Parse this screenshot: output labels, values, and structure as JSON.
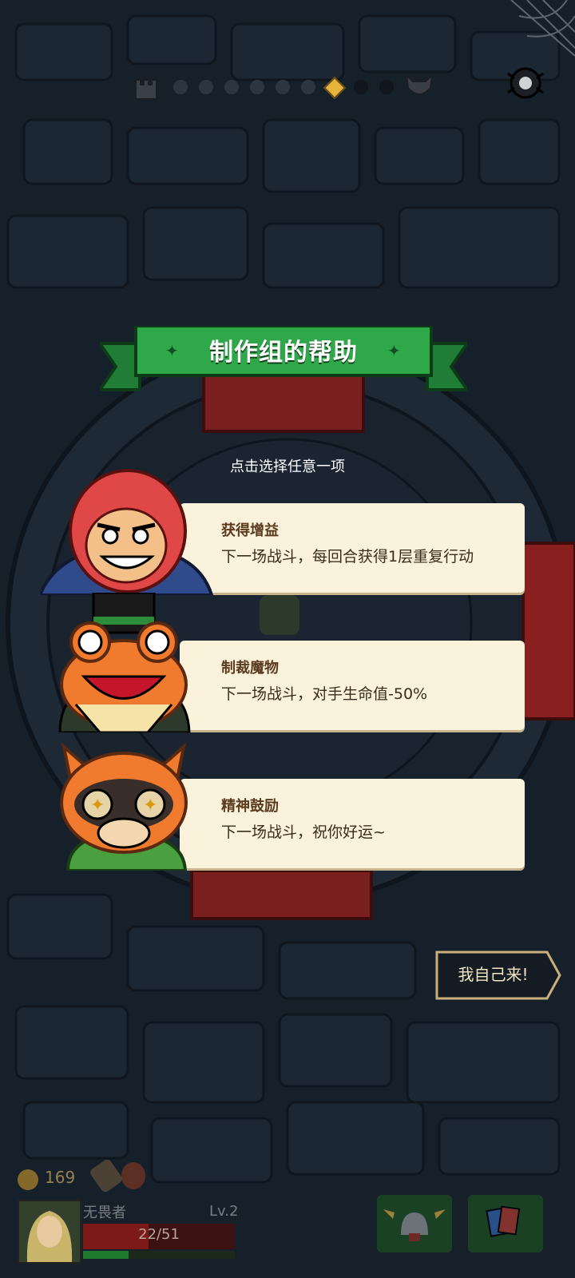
{
  "banner": {
    "title": "制作组的帮助"
  },
  "subtitle": "点击选择任意一项",
  "options": [
    {
      "title": "获得增益",
      "desc": "下一场战斗，每回合获得1层重复行动",
      "portrait": "red-gorilla-icon"
    },
    {
      "title": "制裁魔物",
      "desc": "下一场战斗，对手生命值-50%",
      "portrait": "frog-tophat-icon"
    },
    {
      "title": "精神鼓励",
      "desc": "下一场战斗，祝你好运~",
      "portrait": "raccoon-icon"
    }
  ],
  "myself_button": "我自己来!",
  "progress": {
    "nodes": 9,
    "current_index": 6,
    "start_icon": "castle-icon",
    "end_icon": "demon-skull-icon"
  },
  "hud": {
    "coins": "169",
    "hero_name": "无畏者",
    "level": "Lv.2",
    "hp": "22/51",
    "hp_fraction": 0.43,
    "xp_fraction": 0.3
  },
  "colors": {
    "banner_green": "#2fa84a",
    "card_bg": "#fbf2dc",
    "background": "#15202a"
  }
}
